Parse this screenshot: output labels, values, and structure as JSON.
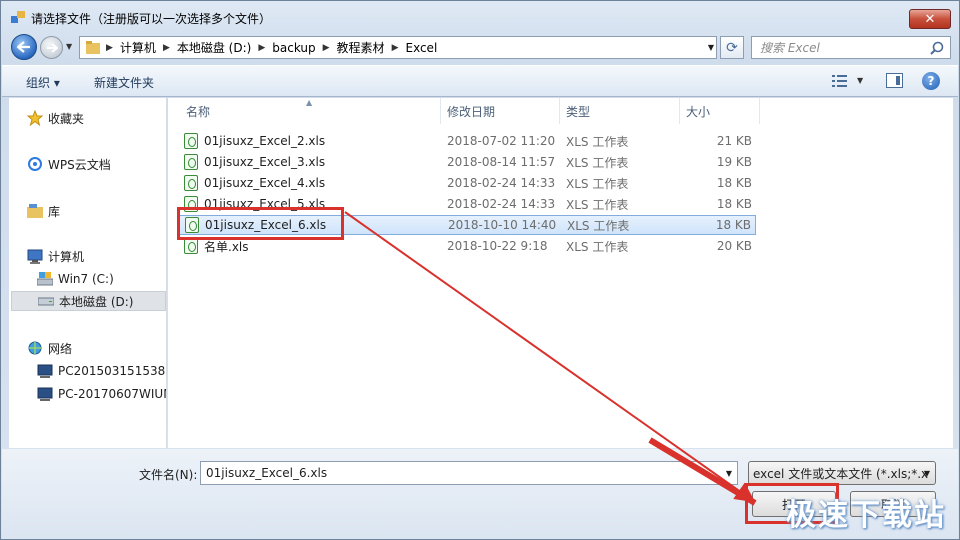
{
  "window": {
    "title": "请选择文件（注册版可以一次选择多个文件）",
    "close_label": "✕"
  },
  "navigation": {
    "breadcrumbs": [
      "计算机",
      "本地磁盘 (D:)",
      "backup",
      "教程素材",
      "Excel"
    ],
    "search_placeholder": "搜索 Excel"
  },
  "toolbar": {
    "organize_label": "组织 ▾",
    "new_folder_label": "新建文件夹"
  },
  "sidebar": {
    "items": [
      {
        "label": "收藏夹",
        "icon": "star-icon"
      },
      {
        "label": "WPS云文档",
        "icon": "cloud-icon"
      },
      {
        "label": "库",
        "icon": "library-icon"
      },
      {
        "label": "计算机",
        "icon": "computer-icon"
      },
      {
        "label": "Win7 (C:)",
        "icon": "drive-icon"
      },
      {
        "label": "本地磁盘 (D:)",
        "icon": "drive-icon",
        "selected": true
      },
      {
        "label": "网络",
        "icon": "network-icon"
      },
      {
        "label": "PC201503151538",
        "icon": "pc-icon"
      },
      {
        "label": "PC-20170607WIUN",
        "icon": "pc-icon"
      }
    ]
  },
  "columns": {
    "name": "名称",
    "modified": "修改日期",
    "type": "类型",
    "size": "大小"
  },
  "files": [
    {
      "name": "01jisuxz_Excel_2.xls",
      "modified": "2018-07-02 11:20",
      "type": "XLS 工作表",
      "size": "21 KB"
    },
    {
      "name": "01jisuxz_Excel_3.xls",
      "modified": "2018-08-14 11:57",
      "type": "XLS 工作表",
      "size": "19 KB"
    },
    {
      "name": "01jisuxz_Excel_4.xls",
      "modified": "2018-02-24 14:33",
      "type": "XLS 工作表",
      "size": "18 KB"
    },
    {
      "name": "01jisuxz_Excel_5.xls",
      "modified": "2018-02-24 14:33",
      "type": "XLS 工作表",
      "size": "18 KB"
    },
    {
      "name": "01jisuxz_Excel_6.xls",
      "modified": "2018-10-10 14:40",
      "type": "XLS 工作表",
      "size": "18 KB",
      "selected": true
    },
    {
      "name": "名单.xls",
      "modified": "2018-10-22 9:18",
      "type": "XLS 工作表",
      "size": "20 KB"
    }
  ],
  "footer": {
    "filename_label": "文件名(N):",
    "filename_value": "01jisuxz_Excel_6.xls",
    "filetype_value": "excel 文件或文本文件 (*.xls;*.x",
    "open_label": "打开",
    "cancel_label": "取消"
  },
  "watermark": "极速下载站",
  "colors": {
    "highlight": "#d9312b",
    "selection": "#cfe4fb"
  }
}
